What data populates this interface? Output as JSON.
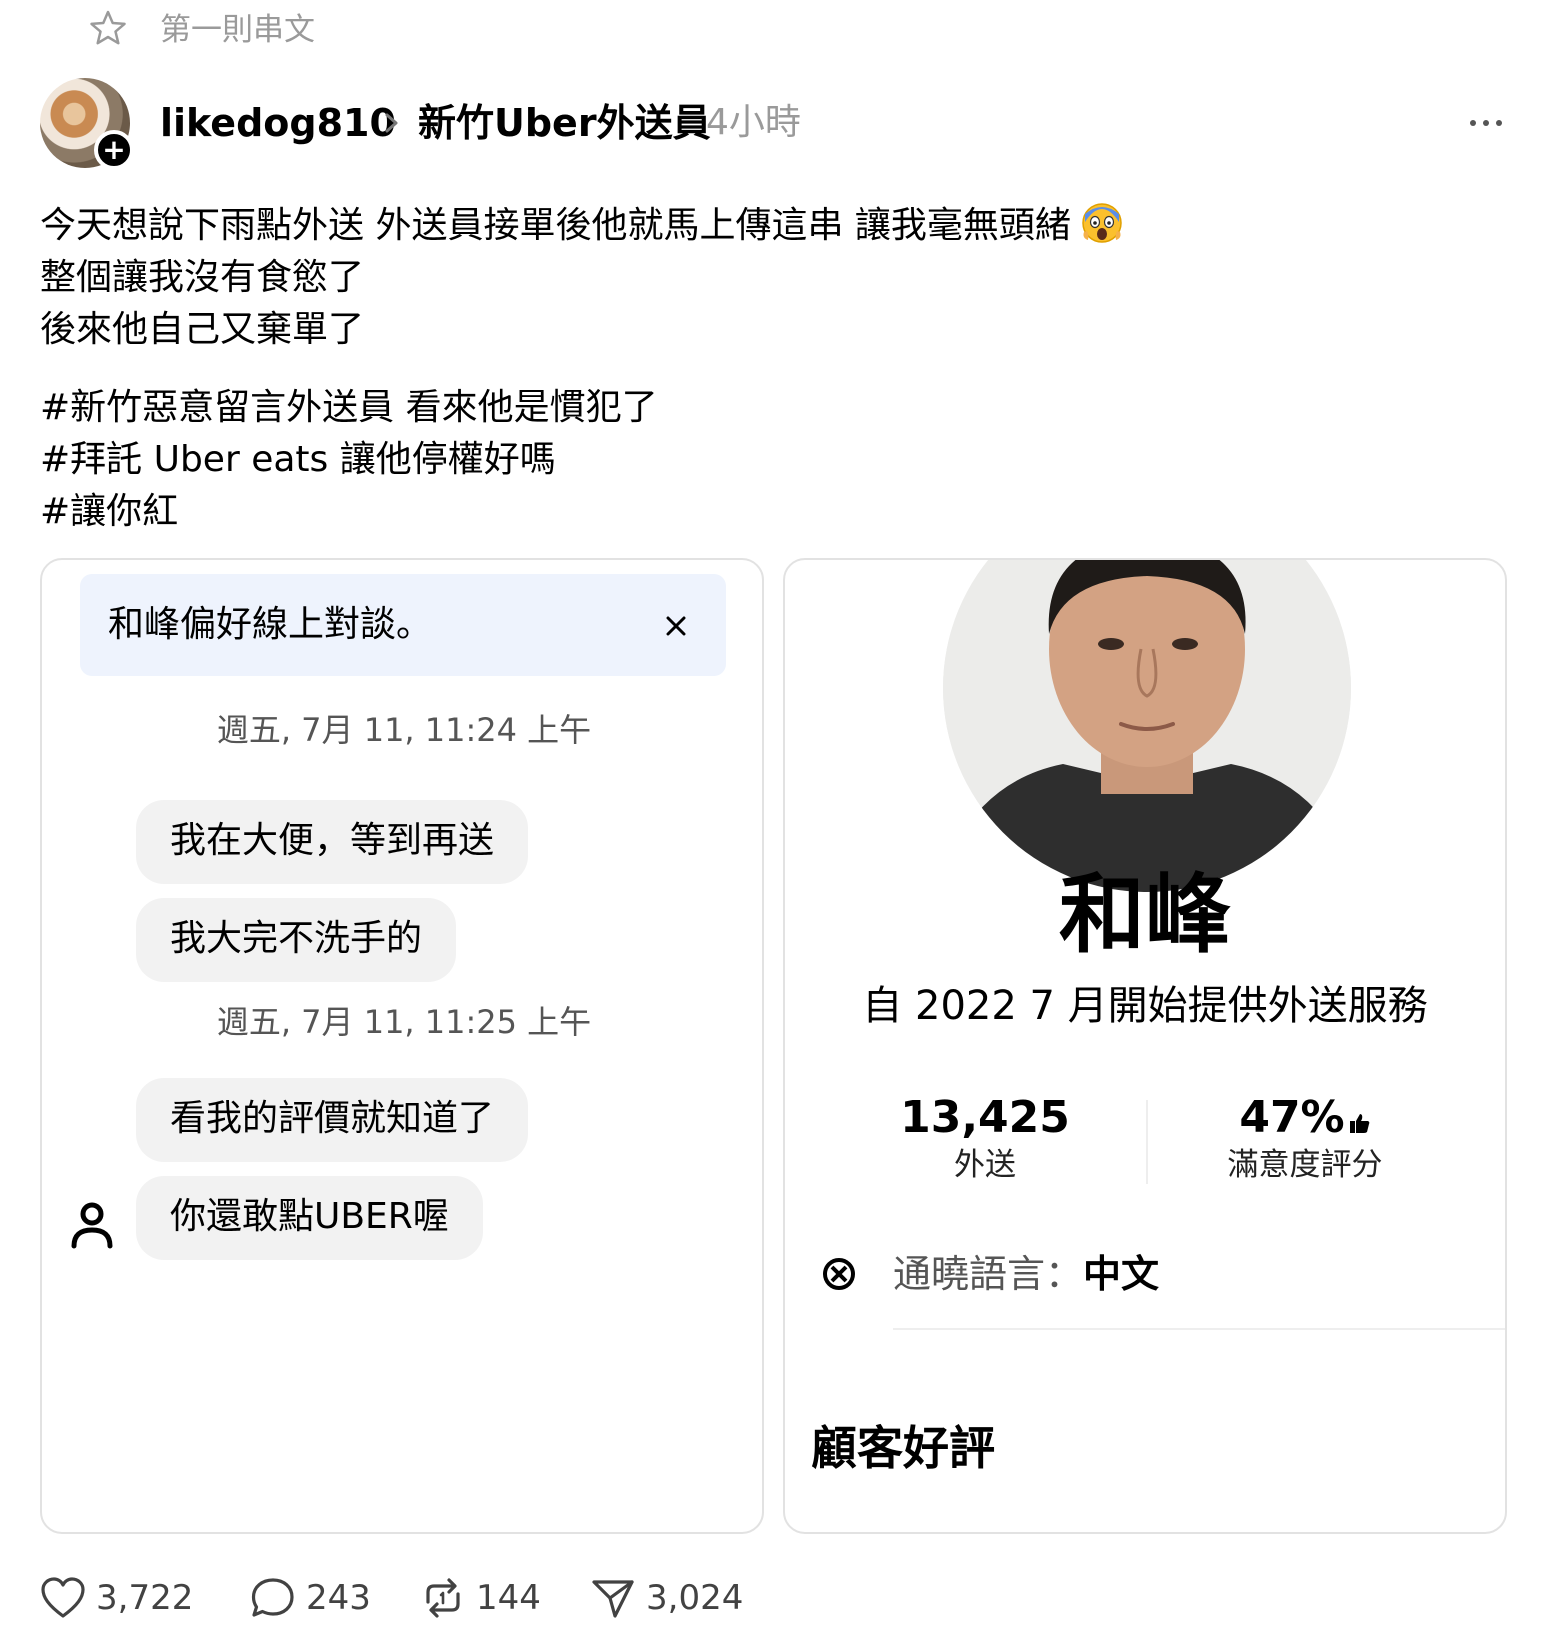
{
  "thread_label": "第一則串文",
  "header": {
    "username": "likedog810",
    "community": "新竹Uber外送員",
    "time": "4小時",
    "follow_symbol": "+"
  },
  "post": {
    "lines": [
      "今天想說下雨點外送 外送員接單後他就馬上傳這串 讓我毫無頭緒",
      "整個讓我沒有食慾了",
      "後來他自己又棄單了"
    ],
    "hashtags": [
      "#新竹惡意留言外送員 看來他是慣犯了",
      "#拜託 Uber eats 讓他停權好嗎",
      "#讓你紅"
    ]
  },
  "chat_screenshot": {
    "preference_banner": "和峰偏好線上對談。",
    "groups": [
      {
        "time": "週五, 7月 11, 11:24 上午",
        "messages": [
          "我在大便，等到再送",
          "我大完不洗手的"
        ]
      },
      {
        "time": "週五, 7月 11, 11:25 上午",
        "messages": [
          "看我的評價就知道了",
          "你還敢點UBER喔"
        ]
      }
    ]
  },
  "profile_screenshot": {
    "name": "和峰",
    "since": "自 2022 7 月開始提供外送服務",
    "stats": [
      {
        "value": "13,425",
        "label": "外送"
      },
      {
        "value": "47%",
        "label": "滿意度評分"
      }
    ],
    "language_label": "通曉語言：",
    "language_value": "中文",
    "reviews_title": "顧客好評"
  },
  "actions": {
    "likes": "3,722",
    "comments": "243",
    "reposts": "144",
    "shares": "3,024"
  },
  "colors": {
    "muted_text": "#9a9a9a",
    "banner_bg": "#eef3fd",
    "bubble_bg": "#f2f2f2",
    "card_border": "#e2e2e2"
  }
}
